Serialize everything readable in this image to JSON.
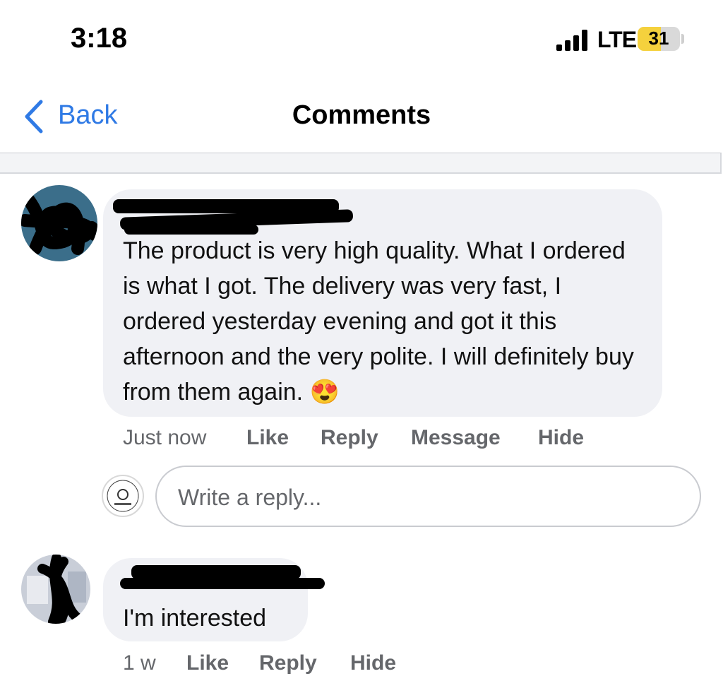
{
  "status_bar": {
    "time": "3:18",
    "network": "LTE",
    "battery": "31"
  },
  "nav": {
    "back_label": "Back",
    "title": "Comments"
  },
  "comments": [
    {
      "author": "",
      "text": "The product is very high quality. What I ordered is what I got. The delivery was very fast, I ordered yesterday evening and got it this afternoon and the very polite. I will definitely buy from them again. 😍",
      "time": "Just now",
      "actions": [
        "Like",
        "Reply",
        "Message",
        "Hide"
      ]
    },
    {
      "author": "",
      "text": "I'm interested",
      "time": "1 w",
      "actions": [
        "Like",
        "Reply",
        "Hide"
      ]
    }
  ],
  "reply_input": {
    "placeholder": "Write a reply..."
  },
  "colors": {
    "accent": "#2f7ae5",
    "bubble": "#f0f1f5",
    "meta": "#65676b",
    "battery": "#f5d13d"
  }
}
